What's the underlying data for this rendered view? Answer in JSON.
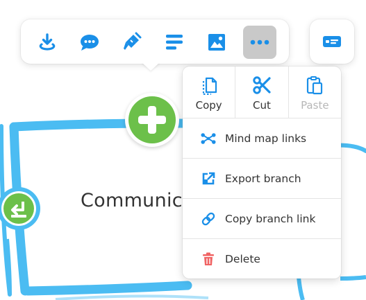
{
  "colors": {
    "accent": "#1a8fe8",
    "connector": "#4bbcf2",
    "add_green": "#6cc04a",
    "delete_red": "#f06363",
    "disabled": "#b7b7b7"
  },
  "toolbar": {
    "buttons": [
      {
        "icon": "download-icon"
      },
      {
        "icon": "comment-icon"
      },
      {
        "icon": "paint-brush-icon"
      },
      {
        "icon": "align-left-icon"
      },
      {
        "icon": "image-icon"
      },
      {
        "icon": "more-icon",
        "active": true
      }
    ],
    "side_button_icon": "card-icon"
  },
  "node": {
    "label": "Communica"
  },
  "context_menu": {
    "clipboard": [
      {
        "label": "Copy",
        "icon": "copy-icon",
        "disabled": false
      },
      {
        "label": "Cut",
        "icon": "scissors-icon",
        "disabled": false
      },
      {
        "label": "Paste",
        "icon": "paste-icon",
        "disabled": true
      }
    ],
    "items": [
      {
        "label": "Mind map links",
        "icon": "mind-map-links-icon"
      },
      {
        "label": "Export branch",
        "icon": "export-icon"
      },
      {
        "label": "Copy branch link",
        "icon": "link-icon"
      },
      {
        "label": "Delete",
        "icon": "trash-icon"
      }
    ]
  }
}
